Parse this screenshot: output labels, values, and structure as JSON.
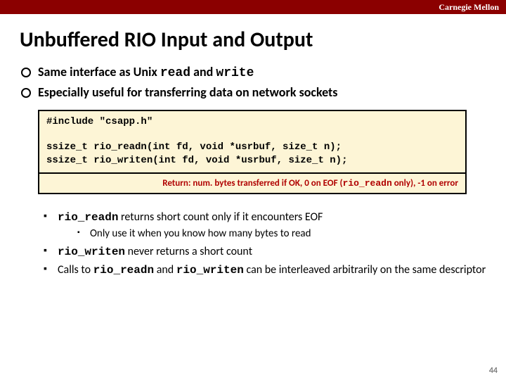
{
  "header": {
    "brand": "Carnegie Mellon"
  },
  "title": "Unbuffered RIO Input and Output",
  "bullets": {
    "b1_pre": "Same interface as Unix ",
    "b1_m1": "read",
    "b1_mid": " and ",
    "b1_m2": "write",
    "b2": "Especially useful for transferring data on network sockets"
  },
  "code": {
    "include": "#include \"csapp.h\"",
    "blank": "",
    "line1": "ssize_t rio_readn(int fd, void *usrbuf, size_t n);",
    "line2": "ssize_t rio_writen(int fd, void *usrbuf, size_t n);",
    "ret_pre": "Return: num. bytes transferred if OK,  0 on EOF (",
    "ret_mono": "rio_readn",
    "ret_post": " only), -1 on error"
  },
  "sub": {
    "s1_m": "rio_readn",
    "s1_post": "  returns short count only if it encounters EOF",
    "s1a": "Only use it when you know how many bytes to read",
    "s2_m": "rio_writen",
    "s2_post": "  never returns a short count",
    "s3_pre": "Calls to ",
    "s3_m1": "rio_readn",
    "s3_mid": " and ",
    "s3_m2": "rio_writen",
    "s3_post": " can be interleaved arbitrarily on the same descriptor"
  },
  "page": "44"
}
